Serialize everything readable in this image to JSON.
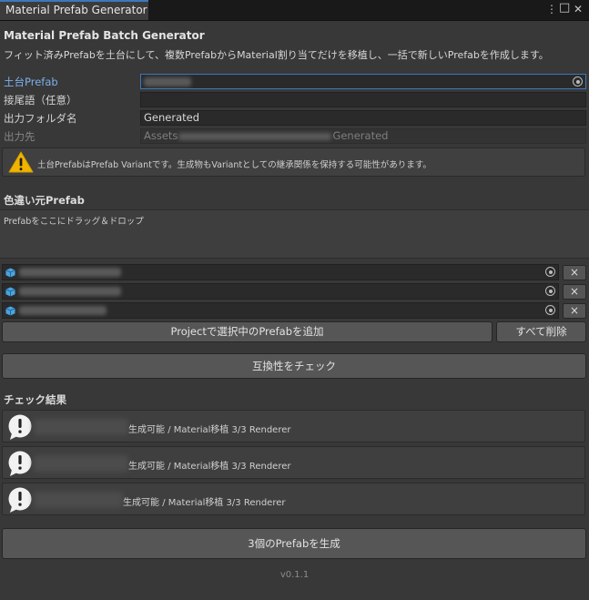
{
  "window": {
    "tab_title": "Material Prefab Generator",
    "menu_glyph": "⋮",
    "maximize_glyph": "□",
    "close_glyph": "✕"
  },
  "header": {
    "title": "Material Prefab Batch Generator",
    "description": "フィット済みPrefabを土台にして、複数PrefabからMaterial割り当てだけを移植し、一括で新しいPrefabを作成します。"
  },
  "fields": {
    "base_prefab_label": "土台Prefab",
    "suffix_label": "接尾語（任意）",
    "suffix_value": "",
    "output_folder_label": "出力フォルダ名",
    "output_folder_value": "Generated",
    "output_path_label": "出力先",
    "output_path_prefix": "Assets",
    "output_path_suffix": "Generated"
  },
  "warning": {
    "icon": "warning-icon",
    "text": "土台PrefabはPrefab Variantです。生成物もVariantとしての継承関係を保持する可能性があります。"
  },
  "sources": {
    "heading": "色違い元Prefab",
    "drop_hint": "Prefabをここにドラッグ＆ドロップ",
    "remove_glyph": "×",
    "add_selected_label": "Projectで選択中のPrefabを追加",
    "clear_all_label": "すべて削除"
  },
  "check_button_label": "互換性をチェック",
  "results": {
    "heading": "チェック結果",
    "items": [
      {
        "status": "生成可能",
        "sep": "/",
        "detail": "Material移植 3/3 Renderer"
      },
      {
        "status": "生成可能",
        "sep": "/",
        "detail": "Material移植 3/3 Renderer"
      },
      {
        "status": "生成可能",
        "sep": "/",
        "detail": "Material移植 3/3 Renderer"
      }
    ]
  },
  "generate_button_label": "3個のPrefabを生成",
  "version": "v0.1.1",
  "colors": {
    "background": "#383838",
    "accent": "#3a79bb",
    "active_label": "#7cb0ea",
    "warning": "#f0b400"
  }
}
